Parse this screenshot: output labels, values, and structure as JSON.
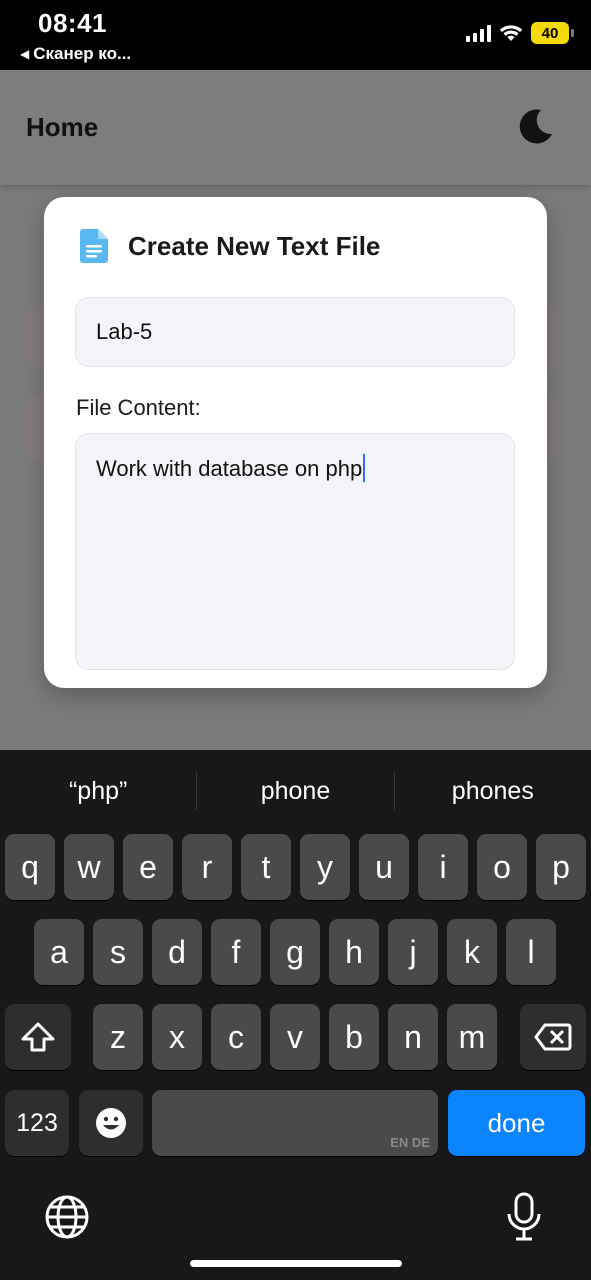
{
  "status_bar": {
    "time": "08:41",
    "back_app": "Сканер ко...",
    "battery": "40"
  },
  "app": {
    "title": "Home",
    "theme_icon": "moon-icon"
  },
  "modal": {
    "icon": "file-text-icon",
    "title": "Create New Text File",
    "file_name_value": "Lab-5",
    "content_label": "File Content:",
    "content_value": "Work with database on php"
  },
  "keyboard": {
    "suggestions": [
      "“php”",
      "phone",
      "phones"
    ],
    "row1": [
      "q",
      "w",
      "e",
      "r",
      "t",
      "y",
      "u",
      "i",
      "o",
      "p"
    ],
    "row2": [
      "a",
      "s",
      "d",
      "f",
      "g",
      "h",
      "j",
      "k",
      "l"
    ],
    "row3": [
      "z",
      "x",
      "c",
      "v",
      "b",
      "n",
      "m"
    ],
    "numbers_key": "123",
    "space_lang_hint": "EN DE",
    "done_key": "done",
    "accent_color": "#0a84ff"
  }
}
